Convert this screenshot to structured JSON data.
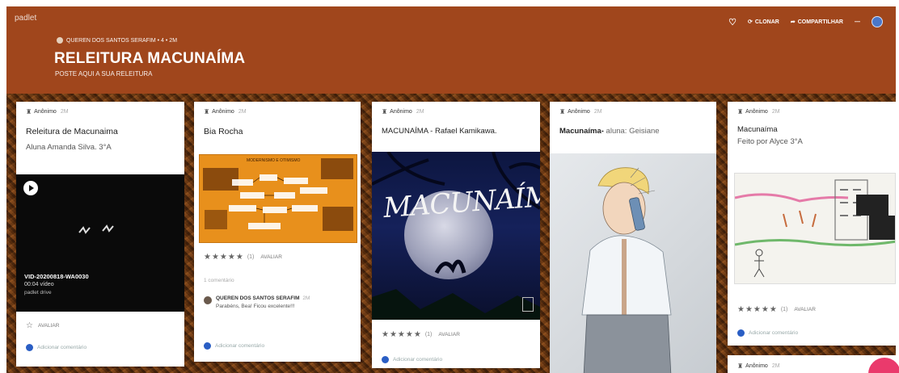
{
  "header": {
    "brand": "padlet",
    "author_line": "QUEREN DOS SANTOS SERAFIM • 4 • 2M",
    "title": "RELEITURA MACUNAÍMA",
    "subtitle": "POSTE AQUI A SUA RELEITURA",
    "actions": {
      "clone": "CLONAR",
      "share": "COMPARTILHAR",
      "more": "—"
    },
    "icons": {
      "heart": "heart-icon",
      "clone": "clone-icon",
      "share": "share-icon"
    },
    "colors": {
      "header_bg": "#a0461c",
      "accent_pink": "#ea3a6c",
      "avatar_blue": "#2a5ec4"
    }
  },
  "posts": [
    {
      "author": "Anônimo",
      "time": "2M",
      "title": "Releitura de Macunaima",
      "body": "Aluna Amanda Silva.   3°A",
      "video": {
        "filename": "VID-20200818-WA0030",
        "info": "00:04 vídeo",
        "source": "padlet drive"
      },
      "rate_label": "AVALIAR",
      "add_comment": "Adicionar comentário"
    },
    {
      "author": "Anônimo",
      "time": "2M",
      "title": "Bia Rocha",
      "image": {
        "heading": "MODERNISMO E OTIMISMO"
      },
      "rating": {
        "stars": 5,
        "count": "(1)",
        "label": "AVALIAR"
      },
      "comments_count": "1 comentário",
      "comment": {
        "author": "QUEREN DOS SANTOS SERAFIM",
        "time": "2M",
        "text": "Parabéns, Bea! Ficou excelente!!!"
      },
      "add_comment": "Adicionar comentário"
    },
    {
      "author": "Anônimo",
      "time": "2M",
      "title": "MACUNAÍMA - Rafael Kamikawa.",
      "image": {
        "text": "MACUNAÍMA"
      },
      "rating": {
        "stars": 5,
        "count": "(1)",
        "label": "AVALIAR"
      },
      "add_comment": "Adicionar comentário"
    },
    {
      "author": "Anônimo",
      "time": "2M",
      "title": "Macunaíma-",
      "title_suffix": " aluna: Geisiane"
    },
    {
      "author": "Anônimo",
      "time": "2M",
      "title": "Macunaíma",
      "body": "Feito por Alyce 3°A",
      "rating": {
        "stars": 5,
        "count": "(1)",
        "label": "AVALIAR"
      },
      "add_comment": "Adicionar comentário"
    },
    {
      "author": "Anônimo",
      "time": "2M"
    }
  ]
}
